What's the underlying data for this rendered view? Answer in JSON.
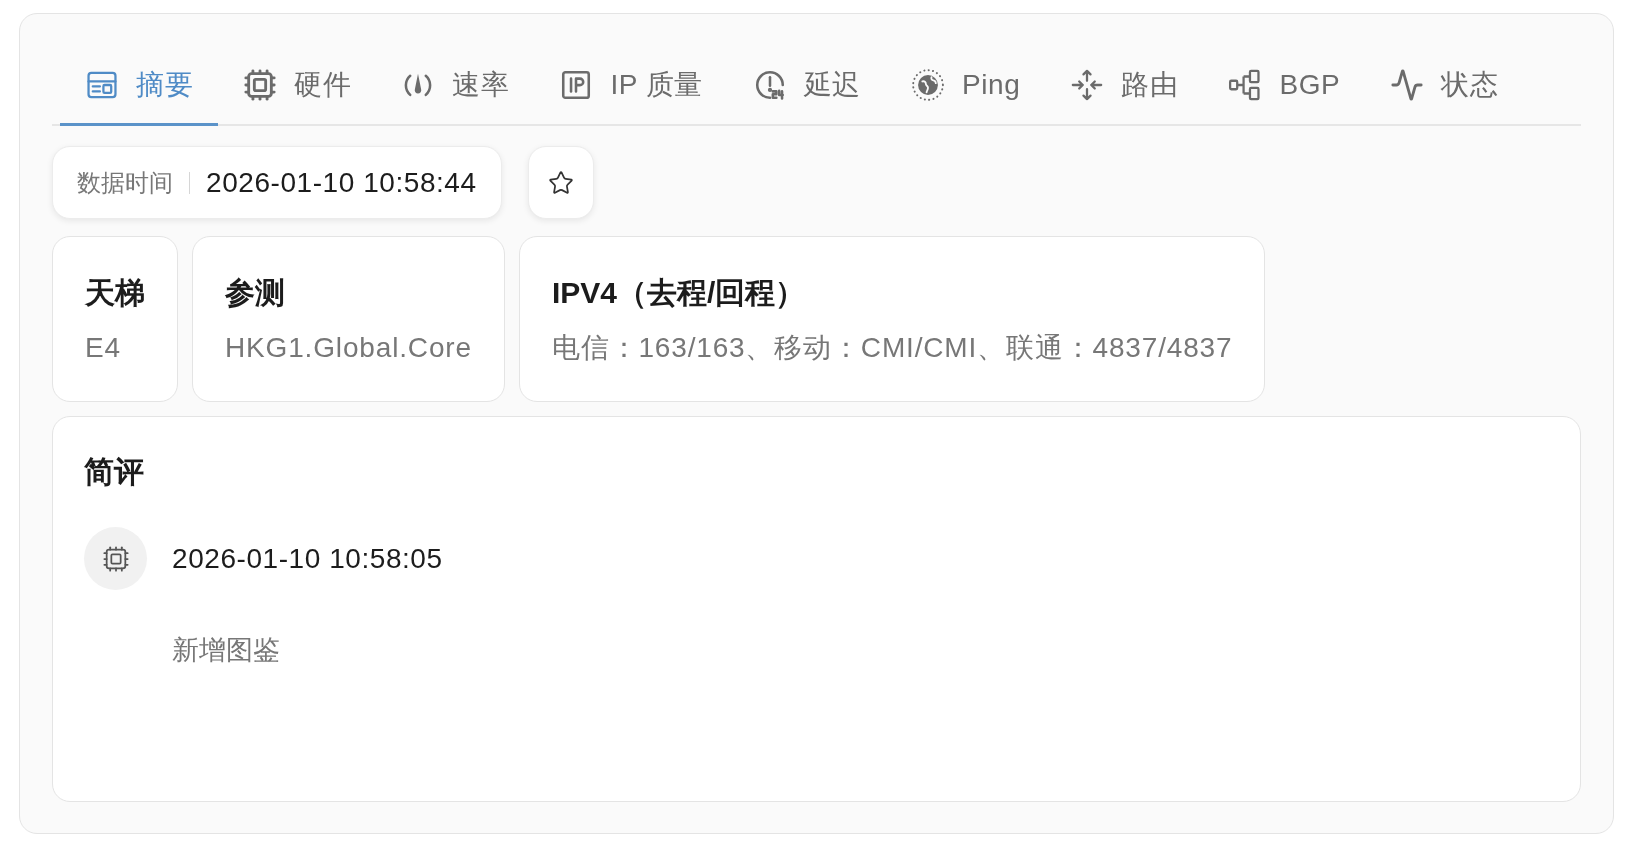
{
  "tabs": [
    {
      "label": "摘要",
      "selected": true
    },
    {
      "label": "硬件",
      "selected": false
    },
    {
      "label": "速率",
      "selected": false
    },
    {
      "label": "IP 质量",
      "selected": false
    },
    {
      "label": "延迟",
      "selected": false
    },
    {
      "label": "Ping",
      "selected": false
    },
    {
      "label": "路由",
      "selected": false
    },
    {
      "label": "BGP",
      "selected": false
    },
    {
      "label": "状态",
      "selected": false
    }
  ],
  "data_time": {
    "label": "数据时间",
    "value": "2026-01-10 10:58:44"
  },
  "info_cards": [
    {
      "title": "天梯",
      "value": "E4"
    },
    {
      "title": "参测",
      "value": "HKG1.Global.Core"
    },
    {
      "title": "IPV4（去程/回程）",
      "value": "电信：163/163、移动：CMI/CMI、联通：4837/4837"
    }
  ],
  "review": {
    "title": "简评",
    "entries": [
      {
        "time": "2026-01-10 10:58:05",
        "text": "新增图鉴"
      }
    ]
  }
}
